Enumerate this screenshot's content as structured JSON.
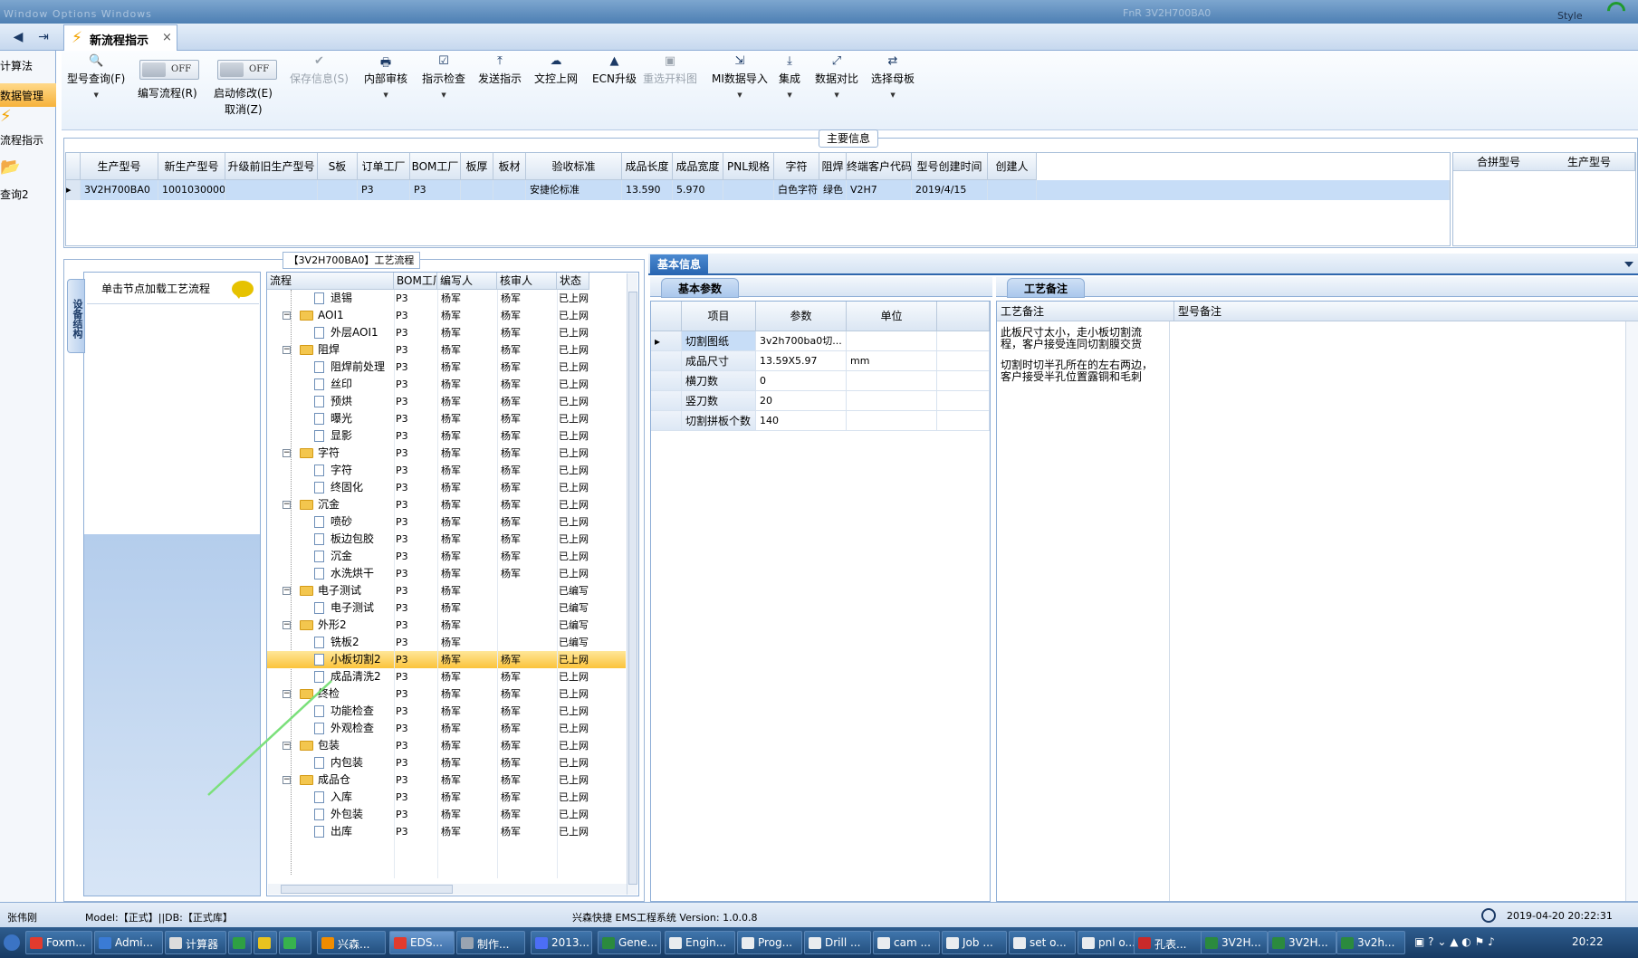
{
  "window": {
    "menu_text": "Window  Options  Windows",
    "right_text": "FnR    3V2H700BA0",
    "style_label": "Style"
  },
  "tabs": {
    "nav_back": "◀",
    "nav_forward": "⇥",
    "active_tab": "新流程指示",
    "close": "×"
  },
  "leftnav": {
    "items": [
      "计算法",
      "数据管理",
      "流程指示",
      "查询2"
    ]
  },
  "toolbar": {
    "query": "型号查询(F)",
    "edit_flow": "编写流程(R)",
    "edit_flow_toggle": "OFF",
    "start_modify": "启动修改(E)",
    "start_modify_toggle": "OFF",
    "cancel": "取消(Z)",
    "save": "保存信息(S)",
    "internal_review": "内部审核",
    "inspect": "指示检查",
    "send": "发送指示",
    "upload": "文控上网",
    "ecn": "ECN升级",
    "reselect": "重选开料图",
    "mi_import": "MI数据导入",
    "integrate": "集成",
    "compare": "数据对比",
    "select_board": "选择母板"
  },
  "main_info": {
    "legend": "主要信息",
    "columns": [
      "生产型号",
      "新生产型号",
      "升级前旧生产型号",
      "S板",
      "订单工厂",
      "BOM工厂",
      "板厚",
      "板材",
      "验收标准",
      "成品长度",
      "成品宽度",
      "PNL规格",
      "字符",
      "阻焊",
      "终端客户代码",
      "型号创建时间",
      "创建人"
    ],
    "row": [
      "3V2H700BA0",
      "10010300002239",
      "",
      "",
      "P3",
      "P3",
      "",
      "",
      "安捷伦标准",
      "13.590",
      "5.970",
      "",
      "白色字符",
      "绿色",
      "V2H7",
      "2019/4/15",
      ""
    ],
    "side_columns": [
      "合拼型号",
      "生产型号"
    ]
  },
  "flow": {
    "legend": "【3V2H700BA0】工艺流程",
    "side_tab": "设备结构",
    "load_hint": "单击节点加载工艺流程",
    "columns": [
      "流程",
      "BOM工厂",
      "编写人",
      "核审人",
      "状态"
    ],
    "rows": [
      {
        "indent": 2,
        "type": "leaf",
        "name": "退锡",
        "bom": "P3",
        "writer": "杨军",
        "reviewer": "杨军",
        "status": "已上网"
      },
      {
        "indent": 1,
        "type": "folder",
        "name": "AOI1",
        "bom": "P3",
        "writer": "杨军",
        "reviewer": "杨军",
        "status": "已上网"
      },
      {
        "indent": 2,
        "type": "leaf",
        "name": "外层AOI1",
        "bom": "P3",
        "writer": "杨军",
        "reviewer": "杨军",
        "status": "已上网"
      },
      {
        "indent": 1,
        "type": "folder",
        "name": "阻焊",
        "bom": "P3",
        "writer": "杨军",
        "reviewer": "杨军",
        "status": "已上网"
      },
      {
        "indent": 2,
        "type": "leaf",
        "name": "阻焊前处理",
        "bom": "P3",
        "writer": "杨军",
        "reviewer": "杨军",
        "status": "已上网"
      },
      {
        "indent": 2,
        "type": "leaf",
        "name": "丝印",
        "bom": "P3",
        "writer": "杨军",
        "reviewer": "杨军",
        "status": "已上网"
      },
      {
        "indent": 2,
        "type": "leaf",
        "name": "预烘",
        "bom": "P3",
        "writer": "杨军",
        "reviewer": "杨军",
        "status": "已上网"
      },
      {
        "indent": 2,
        "type": "leaf",
        "name": "曝光",
        "bom": "P3",
        "writer": "杨军",
        "reviewer": "杨军",
        "status": "已上网"
      },
      {
        "indent": 2,
        "type": "leaf",
        "name": "显影",
        "bom": "P3",
        "writer": "杨军",
        "reviewer": "杨军",
        "status": "已上网"
      },
      {
        "indent": 1,
        "type": "folder",
        "name": "字符",
        "bom": "P3",
        "writer": "杨军",
        "reviewer": "杨军",
        "status": "已上网"
      },
      {
        "indent": 2,
        "type": "leaf",
        "name": "字符",
        "bom": "P3",
        "writer": "杨军",
        "reviewer": "杨军",
        "status": "已上网"
      },
      {
        "indent": 2,
        "type": "leaf",
        "name": "终固化",
        "bom": "P3",
        "writer": "杨军",
        "reviewer": "杨军",
        "status": "已上网"
      },
      {
        "indent": 1,
        "type": "folder",
        "name": "沉金",
        "bom": "P3",
        "writer": "杨军",
        "reviewer": "杨军",
        "status": "已上网"
      },
      {
        "indent": 2,
        "type": "leaf",
        "name": "喷砂",
        "bom": "P3",
        "writer": "杨军",
        "reviewer": "杨军",
        "status": "已上网"
      },
      {
        "indent": 2,
        "type": "leaf",
        "name": "板边包胶",
        "bom": "P3",
        "writer": "杨军",
        "reviewer": "杨军",
        "status": "已上网"
      },
      {
        "indent": 2,
        "type": "leaf",
        "name": "沉金",
        "bom": "P3",
        "writer": "杨军",
        "reviewer": "杨军",
        "status": "已上网"
      },
      {
        "indent": 2,
        "type": "leaf",
        "name": "水洗烘干",
        "bom": "P3",
        "writer": "杨军",
        "reviewer": "杨军",
        "status": "已上网"
      },
      {
        "indent": 1,
        "type": "folder",
        "name": "电子测试",
        "bom": "P3",
        "writer": "杨军",
        "reviewer": "",
        "status": "已编写"
      },
      {
        "indent": 2,
        "type": "leaf",
        "name": "电子测试",
        "bom": "P3",
        "writer": "杨军",
        "reviewer": "",
        "status": "已编写"
      },
      {
        "indent": 1,
        "type": "folder",
        "name": "外形2",
        "bom": "P3",
        "writer": "杨军",
        "reviewer": "",
        "status": "已编写"
      },
      {
        "indent": 2,
        "type": "leaf",
        "name": "铣板2",
        "bom": "P3",
        "writer": "杨军",
        "reviewer": "",
        "status": "已编写"
      },
      {
        "indent": 2,
        "type": "leaf",
        "name": "小板切割2",
        "bom": "P3",
        "writer": "杨军",
        "reviewer": "杨军",
        "status": "已上网",
        "selected": true
      },
      {
        "indent": 2,
        "type": "leaf",
        "name": "成品清洗2",
        "bom": "P3",
        "writer": "杨军",
        "reviewer": "杨军",
        "status": "已上网"
      },
      {
        "indent": 1,
        "type": "folder",
        "name": "终检",
        "bom": "P3",
        "writer": "杨军",
        "reviewer": "杨军",
        "status": "已上网"
      },
      {
        "indent": 2,
        "type": "leaf",
        "name": "功能检查",
        "bom": "P3",
        "writer": "杨军",
        "reviewer": "杨军",
        "status": "已上网"
      },
      {
        "indent": 2,
        "type": "leaf",
        "name": "外观检查",
        "bom": "P3",
        "writer": "杨军",
        "reviewer": "杨军",
        "status": "已上网"
      },
      {
        "indent": 1,
        "type": "folder",
        "name": "包装",
        "bom": "P3",
        "writer": "杨军",
        "reviewer": "杨军",
        "status": "已上网"
      },
      {
        "indent": 2,
        "type": "leaf",
        "name": "内包装",
        "bom": "P3",
        "writer": "杨军",
        "reviewer": "杨军",
        "status": "已上网"
      },
      {
        "indent": 1,
        "type": "folder",
        "name": "成品仓",
        "bom": "P3",
        "writer": "杨军",
        "reviewer": "杨军",
        "status": "已上网"
      },
      {
        "indent": 2,
        "type": "leaf",
        "name": "入库",
        "bom": "P3",
        "writer": "杨军",
        "reviewer": "杨军",
        "status": "已上网"
      },
      {
        "indent": 2,
        "type": "leaf",
        "name": "外包装",
        "bom": "P3",
        "writer": "杨军",
        "reviewer": "杨军",
        "status": "已上网"
      },
      {
        "indent": 2,
        "type": "leaf",
        "name": "出库",
        "bom": "P3",
        "writer": "杨军",
        "reviewer": "杨军",
        "status": "已上网"
      }
    ]
  },
  "basic_info": {
    "tab": "基本信息",
    "params_tab": "基本参数",
    "columns": [
      "项目",
      "参数",
      "单位"
    ],
    "rows": [
      {
        "item": "切割图纸",
        "value": "3v2h700ba0切...",
        "unit": ""
      },
      {
        "item": "成品尺寸",
        "value": "13.59X5.97",
        "unit": "mm"
      },
      {
        "item": "横刀数",
        "value": "0",
        "unit": ""
      },
      {
        "item": "竖刀数",
        "value": "20",
        "unit": ""
      },
      {
        "item": "切割拼板个数",
        "value": "140",
        "unit": ""
      }
    ]
  },
  "memo": {
    "tab": "工艺备注",
    "col_process": "工艺备注",
    "col_model": "型号备注",
    "text_line1": "此板尺寸太小，走小板切割流程，客户接受连同切割膜交货",
    "text_line2": "切割时切半孔所在的左右两边，客户接受半孔位置露铜和毛刺"
  },
  "statusbar": {
    "user": "张伟刚",
    "model_db": "Model:【正式】||DB:【正式库】",
    "system": "兴森快捷  EMS工程系统  Version: 1.0.0.8",
    "datetime": "2019-04-20 20:22:31"
  },
  "taskbar": {
    "items": [
      "Foxm...",
      "Admi...",
      "计算器",
      "",
      "",
      "",
      "兴森...",
      "EDS...",
      "制作...",
      "2013...",
      "Gene...",
      "Engin...",
      "Prog...",
      "Drill ...",
      "cam ...",
      "Job ...",
      "set o...",
      "pnl o...",
      "孔表...",
      "3V2H...",
      "3V2H...",
      "3v2h..."
    ],
    "clock": "20:22"
  },
  "colors": {
    "accent": "#2864b0",
    "selection": "#fbc33b",
    "row_selected": "#c7ddf7"
  }
}
